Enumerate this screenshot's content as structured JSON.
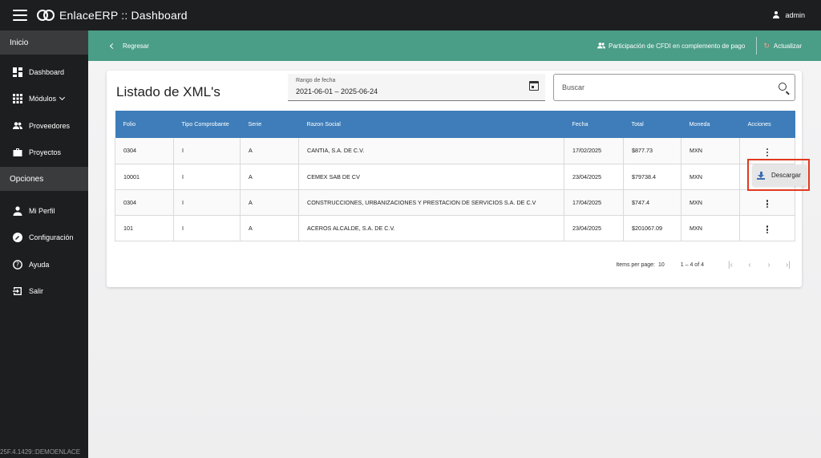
{
  "app": {
    "title": "EnlaceERP :: Dashboard",
    "user": "admin",
    "version": "25F.4.1429::DEMOENLACE"
  },
  "sidebar": {
    "section_inicio": "Inicio",
    "section_opciones": "Opciones",
    "items": [
      {
        "label": "Dashboard",
        "icon": "dashboard-icon"
      },
      {
        "label": "Módulos",
        "icon": "grid-icon"
      },
      {
        "label": "Proveedores",
        "icon": "people-icon"
      },
      {
        "label": "Proyectos",
        "icon": "briefcase-icon"
      },
      {
        "label": "Mi Perfil",
        "icon": "person-icon"
      },
      {
        "label": "Configuración",
        "icon": "settings-icon"
      },
      {
        "label": "Ayuda",
        "icon": "help-icon"
      },
      {
        "label": "Salir",
        "icon": "exit-icon"
      }
    ]
  },
  "actionbar": {
    "back": "Regresar",
    "cfdi": "Participación de CFDI en complemento de pago",
    "refresh": "Actualizar"
  },
  "main": {
    "title": "Listado de XML's",
    "date_label": "Rango de fecha",
    "date_value": "2021-06-01 – 2025-06-24",
    "search_placeholder": "Buscar",
    "columns": [
      "Folio",
      "Tipo Comprobante",
      "Serie",
      "Razon Social",
      "Fecha",
      "Total",
      "Moneda",
      "Acciones"
    ],
    "rows": [
      [
        "0304",
        "I",
        "A",
        "CANTIA, S.A. DE C.V.",
        "17/02/2025",
        "$877.73",
        "MXN"
      ],
      [
        "10001",
        "I",
        "A",
        "CEMEX SAB DE CV",
        "23/04/2025",
        "$79738.4",
        "MXN"
      ],
      [
        "0304",
        "I",
        "A",
        "CONSTRUCCIONES, URBANIZACIONES Y PRESTACION DE SERVICIOS S.A. DE C.V",
        "17/04/2025",
        "$747.4",
        "MXN"
      ],
      [
        "101",
        "I",
        "A",
        "ACEROS ALCALDE, S.A. DE C.V.",
        "23/04/2025",
        "$201067.09",
        "MXN"
      ]
    ],
    "download_label": "Descargar",
    "highlight_color": "#e2391e",
    "paginator": {
      "items_label": "Items per page:",
      "page_size": "10",
      "range": "1 – 4 of 4"
    }
  },
  "colors": {
    "actionbar": "#4a9d86",
    "table_header": "#3e7db9",
    "sidebar": "#1d1e20"
  }
}
